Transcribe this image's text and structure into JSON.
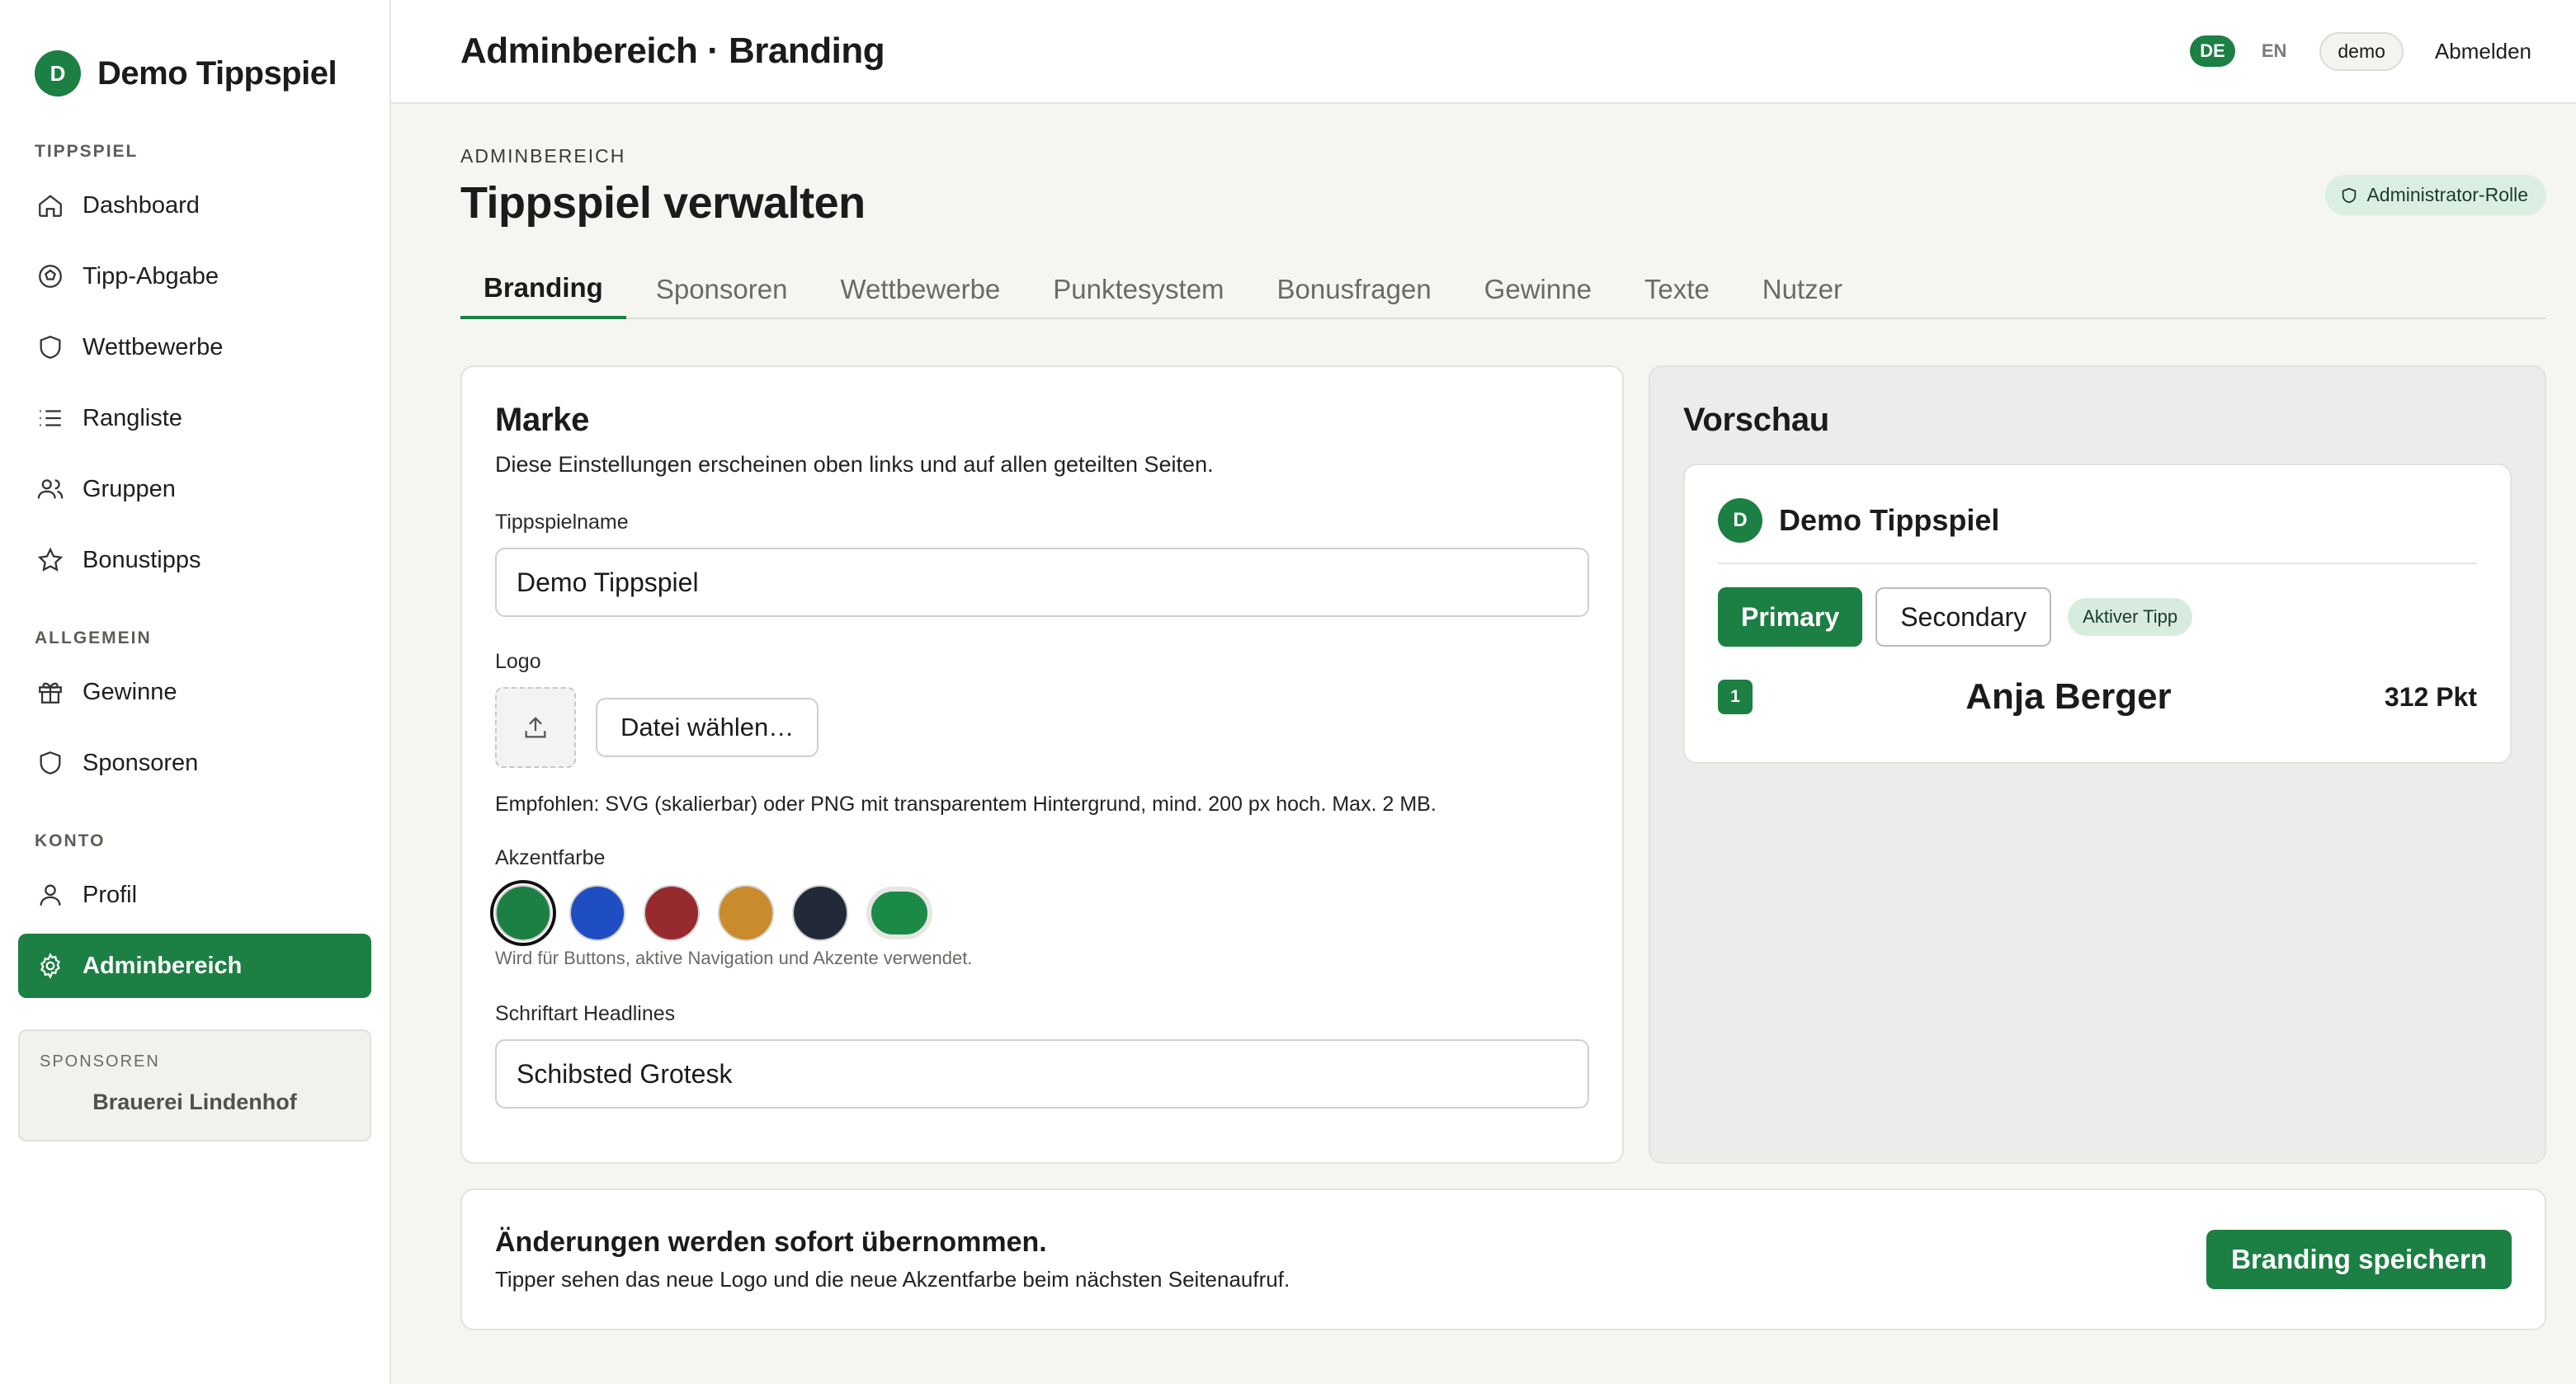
{
  "brand": {
    "initial": "D",
    "name": "Demo Tippspiel"
  },
  "sidebar": {
    "sections": [
      {
        "label": "TIPPSPIEL",
        "items": [
          {
            "label": "Dashboard",
            "icon": "home-icon"
          },
          {
            "label": "Tipp-Abgabe",
            "icon": "ball-icon"
          },
          {
            "label": "Wettbewerbe",
            "icon": "shield-icon"
          },
          {
            "label": "Rangliste",
            "icon": "list-icon"
          },
          {
            "label": "Gruppen",
            "icon": "users-icon"
          },
          {
            "label": "Bonustipps",
            "icon": "star-icon"
          }
        ]
      },
      {
        "label": "ALLGEMEIN",
        "items": [
          {
            "label": "Gewinne",
            "icon": "gift-icon"
          },
          {
            "label": "Sponsoren",
            "icon": "shield-icon"
          }
        ]
      },
      {
        "label": "KONTO",
        "items": [
          {
            "label": "Profil",
            "icon": "user-icon"
          },
          {
            "label": "Adminbereich",
            "icon": "gear-icon",
            "active": true
          }
        ]
      }
    ],
    "sponsor_box": {
      "label": "SPONSOREN",
      "name": "Brauerei Lindenhof"
    }
  },
  "header": {
    "title": "Adminbereich · Branding",
    "lang_de": "DE",
    "lang_en": "EN",
    "user": "demo",
    "logout": "Abmelden"
  },
  "page": {
    "eyebrow": "ADMINBEREICH",
    "title": "Tippspiel verwalten",
    "role": "Administrator-Rolle"
  },
  "tabs": [
    "Branding",
    "Sponsoren",
    "Wettbewerbe",
    "Punktesystem",
    "Bonusfragen",
    "Gewinne",
    "Texte",
    "Nutzer"
  ],
  "marke": {
    "title": "Marke",
    "description": "Diese Einstellungen erscheinen oben links und auf allen geteilten Seiten.",
    "name_label": "Tippspielname",
    "name_value": "Demo Tippspiel",
    "logo_label": "Logo",
    "file_button": "Datei wählen…",
    "logo_hint": "Empfohlen: SVG (skalierbar) oder PNG mit transparentem Hintergrund, mind. 200 px hoch. Max. 2 MB.",
    "accent_label": "Akzentfarbe",
    "accent_colors": [
      "#1c7f43",
      "#1f4ec2",
      "#962a2f",
      "#c98b2b",
      "#222a3a"
    ],
    "accent_custom_color": "#1c8a47",
    "accent_hint": "Wird für Buttons, aktive Navigation und Akzente verwendet.",
    "font_label": "Schriftart Headlines",
    "font_value": "Schibsted Grotesk"
  },
  "preview": {
    "title": "Vorschau",
    "brand_initial": "D",
    "brand_name": "Demo Tippspiel",
    "primary": "Primary",
    "secondary": "Secondary",
    "tip_pill": "Aktiver Tipp",
    "rank": "1",
    "player": "Anja Berger",
    "points": "312 Pkt"
  },
  "footer": {
    "title": "Änderungen werden sofort übernommen.",
    "subtitle": "Tipper sehen das neue Logo und die neue Akzentfarbe beim nächsten Seitenaufruf.",
    "save": "Branding speichern"
  },
  "colors": {
    "accent": "#1c7f43"
  }
}
